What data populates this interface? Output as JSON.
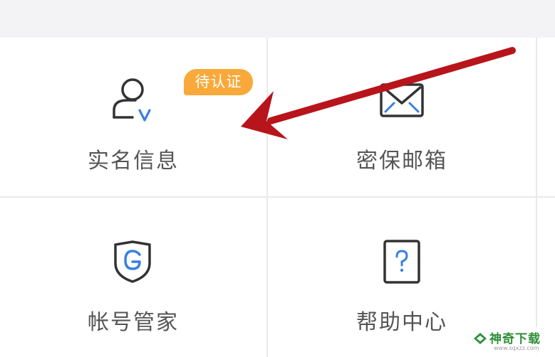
{
  "grid": {
    "items": [
      {
        "label": "实名信息",
        "icon": "user-verify-icon",
        "badge": "待认证"
      },
      {
        "label": "密保邮箱",
        "icon": "mail-icon"
      },
      {
        "label": "帐号管家",
        "icon": "shield-g-icon"
      },
      {
        "label": "帮助中心",
        "icon": "help-question-icon"
      }
    ]
  },
  "watermark": {
    "text": "神奇下载",
    "sub": "www.sqxzz.com"
  },
  "colors": {
    "badge": "#f8a93a",
    "icon_stroke": "#333333",
    "icon_accent": "#3b7fe0",
    "arrow": "#b8141b",
    "label": "#555555",
    "divider": "#e9e9ec"
  }
}
